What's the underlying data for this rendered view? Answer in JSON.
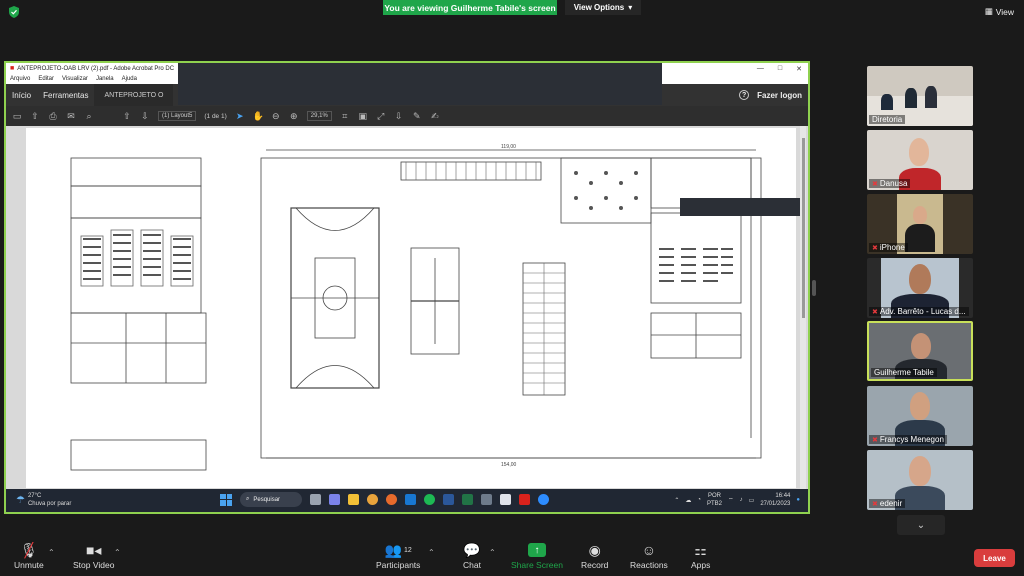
{
  "banner": {
    "text": "You are viewing Guilherme Tabile's screen",
    "view_options": "View Options",
    "view_label": "View"
  },
  "acrobat": {
    "title": "ANTEPROJETO-OAB LRV (2).pdf - Adobe Acrobat Pro DC",
    "menu": [
      "Arquivo",
      "Editar",
      "Visualizar",
      "Janela",
      "Ajuda"
    ],
    "tabs": {
      "inicio": "Início",
      "ferramentas": "Ferramentas",
      "doc": "ANTEPROJETO O"
    },
    "login": "Fazer logon",
    "page_indicator": "(1) Layout5",
    "page_of": "(1 de 1)",
    "zoom": "29,1%"
  },
  "drawing": {
    "dim_top": "119,00",
    "dim_bottom": "154,00"
  },
  "taskbar": {
    "temp": "27°C",
    "weather": "Chuva por parar",
    "search": "Pesquisar",
    "lang1": "POR",
    "lang2": "PTB2",
    "time": "16:44",
    "date": "27/01/2023"
  },
  "participants": [
    {
      "name": "Diretoria",
      "muted": false
    },
    {
      "name": "Danusa",
      "muted": true
    },
    {
      "name": "iPhone",
      "muted": true
    },
    {
      "name": "Adv. Barrêto - Lucas d...",
      "muted": true
    },
    {
      "name": "Guilherme Tabile",
      "muted": false
    },
    {
      "name": "Francys Menegon",
      "muted": true
    },
    {
      "name": "edenir",
      "muted": true
    }
  ],
  "controls": {
    "unmute": "Unmute",
    "stop_video": "Stop Video",
    "participants": "Participants",
    "participants_count": "12",
    "chat": "Chat",
    "share": "Share Screen",
    "record": "Record",
    "reactions": "Reactions",
    "apps": "Apps",
    "leave": "Leave"
  },
  "colors": {
    "share_green": "#1fa64a",
    "active_border": "#c8e05a",
    "leave_red": "#d93d3d",
    "frame_green": "#8fd14f"
  }
}
